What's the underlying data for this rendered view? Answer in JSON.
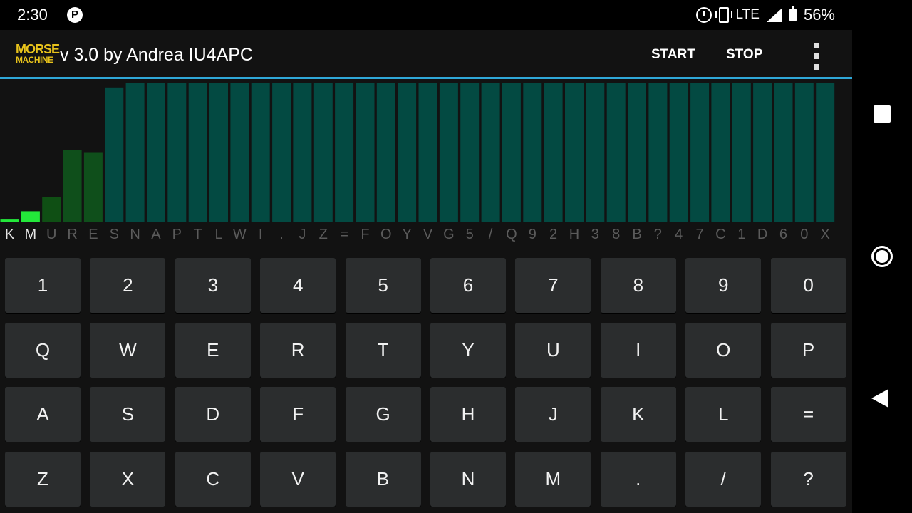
{
  "status_bar": {
    "time": "2:30",
    "left_icon": "P",
    "network": "LTE",
    "battery": "56%",
    "icons": [
      "alarm-icon",
      "vibrate-icon",
      "signal-icon",
      "battery-icon"
    ]
  },
  "toolbar": {
    "logo_line1": "MORSE",
    "logo_line2": "MACHINE",
    "title": "v 3.0 by Andrea IU4APC",
    "start_label": "START",
    "stop_label": "STOP",
    "logo_color": "#e7c21b",
    "accent_color": "#2fa7d8"
  },
  "chart_data": {
    "type": "bar",
    "categories": [
      "K",
      "M",
      "U",
      "R",
      "E",
      "S",
      "N",
      "A",
      "P",
      "T",
      "L",
      "W",
      "I",
      ".",
      "J",
      "Z",
      "=",
      "F",
      "O",
      "Y",
      "V",
      "G",
      "5",
      "/",
      "Q",
      "9",
      "2",
      "H",
      "3",
      "8",
      "B",
      "?",
      "4",
      "7",
      "C",
      "1",
      "D",
      "6",
      "0",
      "X"
    ],
    "values": [
      2,
      8,
      18,
      52,
      50,
      97,
      100,
      100,
      100,
      100,
      100,
      100,
      100,
      100,
      100,
      100,
      100,
      100,
      100,
      100,
      100,
      100,
      100,
      100,
      100,
      100,
      100,
      100,
      100,
      100,
      100,
      100,
      100,
      100,
      100,
      100,
      100,
      100,
      100,
      100
    ],
    "colors": [
      "#23e83a",
      "#23e83a",
      "#0f4f14",
      "#0f4f1b",
      "#0f4f1b",
      "#034a42",
      "#034a42",
      "#034a42",
      "#034a42",
      "#034a42",
      "#034a42",
      "#034a42",
      "#034a42",
      "#034a42",
      "#034a42",
      "#034a42",
      "#034a42",
      "#034a42",
      "#034a42",
      "#034a42",
      "#034a42",
      "#034a42",
      "#034a42",
      "#034a42",
      "#034a42",
      "#034a42",
      "#034a42",
      "#034a42",
      "#034a42",
      "#034a42",
      "#034a42",
      "#034a42",
      "#034a42",
      "#034a42",
      "#034a42",
      "#034a42",
      "#034a42",
      "#034a42",
      "#034a42",
      "#034a42"
    ],
    "active_letters": [
      "K",
      "M"
    ],
    "ylim": [
      0,
      100
    ],
    "title": "",
    "xlabel": "",
    "ylabel": ""
  },
  "keyboard": {
    "rows": [
      [
        "1",
        "2",
        "3",
        "4",
        "5",
        "6",
        "7",
        "8",
        "9",
        "0"
      ],
      [
        "Q",
        "W",
        "E",
        "R",
        "T",
        "Y",
        "U",
        "I",
        "O",
        "P"
      ],
      [
        "A",
        "S",
        "D",
        "F",
        "G",
        "H",
        "J",
        "K",
        "L",
        "="
      ],
      [
        "Z",
        "X",
        "C",
        "V",
        "B",
        "N",
        "M",
        ".",
        "/",
        "?"
      ]
    ]
  },
  "nav_bar": {
    "icons": [
      "recents-square-icon",
      "home-circle-icon",
      "back-triangle-icon"
    ]
  }
}
